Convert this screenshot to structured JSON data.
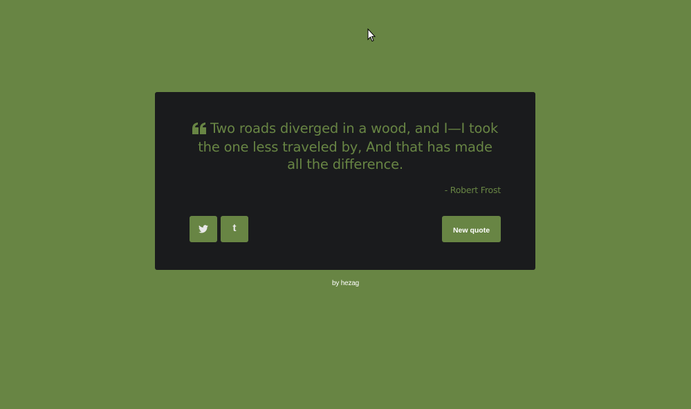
{
  "quote": {
    "text": "Two roads diverged in a wood, and I—I took the one less traveled by, And that has made all the difference.",
    "author": "- Robert Frost"
  },
  "buttons": {
    "new_quote_label": "New quote",
    "twitter_icon": "twitter-icon",
    "tumblr_icon": "tumblr-icon"
  },
  "footer": {
    "credit": "by hezag"
  },
  "colors": {
    "background": "#688544",
    "card": "#1a1b1d",
    "accent": "#688544",
    "button_text": "#ffffff"
  }
}
